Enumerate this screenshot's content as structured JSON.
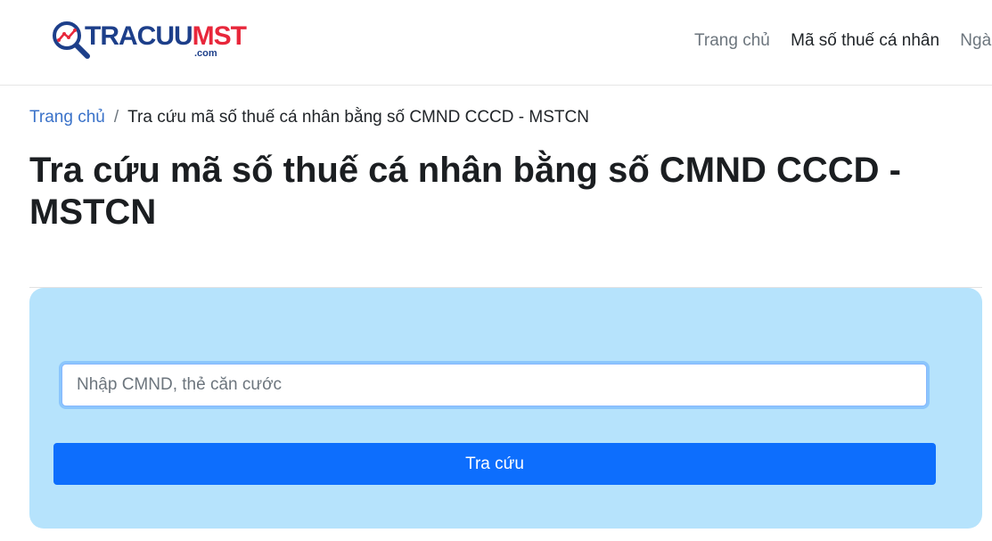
{
  "brand": {
    "logo_part1": "TRACUU",
    "logo_part2": "MST",
    "logo_suffix": ".com",
    "colors": {
      "primary": "#1d3f8a",
      "accent": "#e8273b"
    },
    "icon": "magnifier-chart-icon"
  },
  "nav": {
    "items": [
      {
        "label": "Trang chủ"
      },
      {
        "label": "Mã số thuế cá nhân"
      },
      {
        "label": "Ngà"
      }
    ]
  },
  "breadcrumb": {
    "home": "Trang chủ",
    "separator": "/",
    "current": "Tra cứu mã số thuế cá nhân bằng số CMND CCCD - MSTCN"
  },
  "page": {
    "title": "Tra cứu mã số thuế cá nhân bằng số CMND CCCD - MSTCN"
  },
  "search": {
    "value": "",
    "placeholder": "Nhập CMND, thẻ căn cước",
    "button_label": "Tra cứu",
    "colors": {
      "panel_bg": "#b6e3fc",
      "button_bg": "#0d6efd"
    }
  }
}
